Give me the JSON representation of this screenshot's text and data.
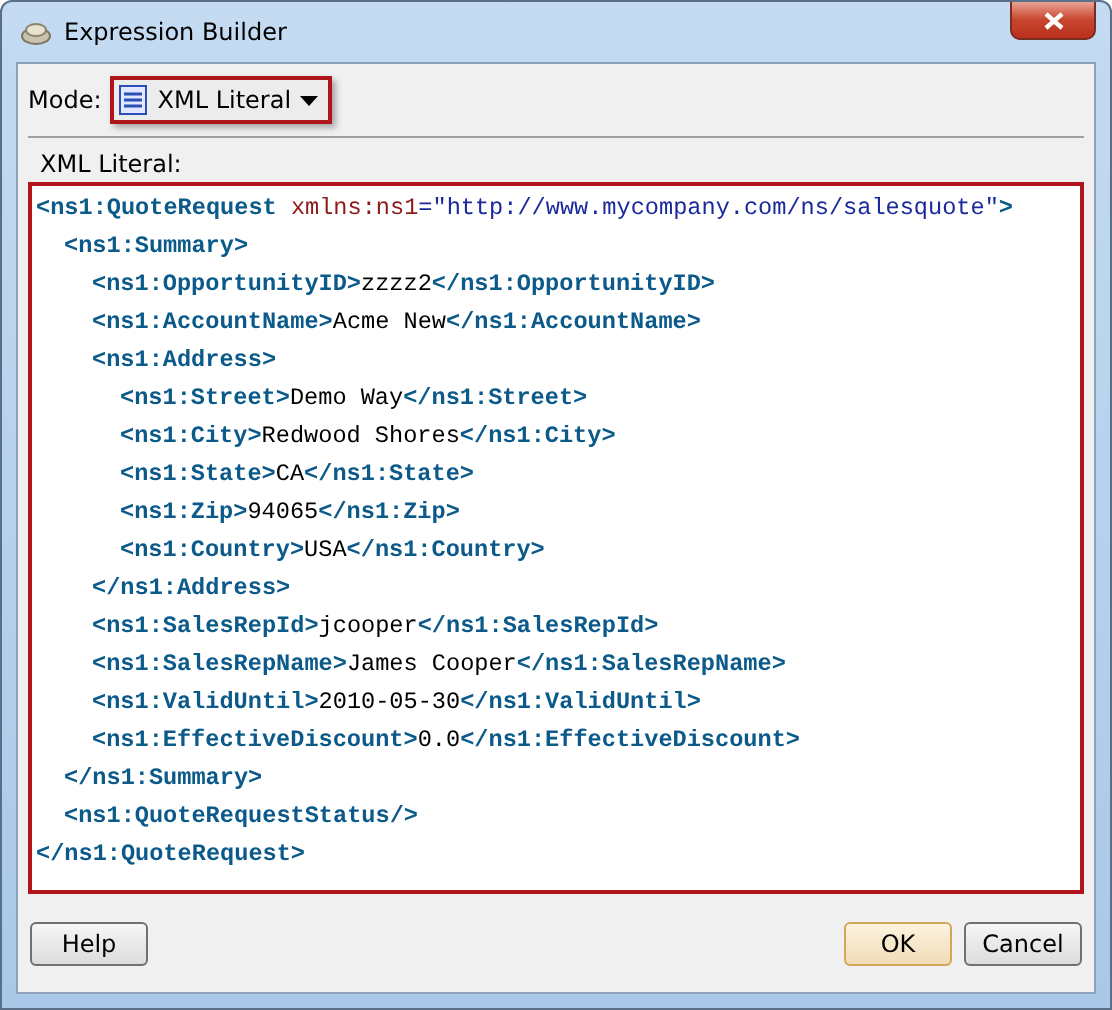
{
  "window": {
    "title": "Expression Builder"
  },
  "mode": {
    "label": "Mode:",
    "value": "XML Literal"
  },
  "editor": {
    "label": "XML Literal:",
    "tree": [
      {
        "parts": [
          {
            "kind": "tag",
            "text": "<ns1:QuoteRequest "
          },
          {
            "kind": "attr",
            "text": "xmlns:ns1"
          },
          {
            "kind": "value",
            "text": "=\"http://www.mycompany.com/ns/salesquote\""
          },
          {
            "kind": "tag",
            "text": ">"
          }
        ],
        "close": [
          {
            "kind": "tag",
            "text": "</ns1:QuoteRequest>"
          }
        ],
        "children": [
          {
            "parts": [
              {
                "kind": "tag",
                "text": "<ns1:Summary>"
              }
            ],
            "close": [
              {
                "kind": "tag",
                "text": "</ns1:Summary>"
              }
            ],
            "children": [
              {
                "parts": [
                  {
                    "kind": "tag",
                    "text": "<ns1:OpportunityID>"
                  },
                  {
                    "kind": "text",
                    "text": "zzzz2"
                  },
                  {
                    "kind": "tag",
                    "text": "</ns1:OpportunityID>"
                  }
                ]
              },
              {
                "parts": [
                  {
                    "kind": "tag",
                    "text": "<ns1:AccountName>"
                  },
                  {
                    "kind": "text",
                    "text": "Acme New"
                  },
                  {
                    "kind": "tag",
                    "text": "</ns1:AccountName>"
                  }
                ]
              },
              {
                "parts": [
                  {
                    "kind": "tag",
                    "text": "<ns1:Address>"
                  }
                ],
                "close": [
                  {
                    "kind": "tag",
                    "text": "</ns1:Address>"
                  }
                ],
                "children": [
                  {
                    "parts": [
                      {
                        "kind": "tag",
                        "text": "<ns1:Street>"
                      },
                      {
                        "kind": "text",
                        "text": "Demo Way"
                      },
                      {
                        "kind": "tag",
                        "text": "</ns1:Street>"
                      }
                    ]
                  },
                  {
                    "parts": [
                      {
                        "kind": "tag",
                        "text": "<ns1:City>"
                      },
                      {
                        "kind": "text",
                        "text": "Redwood Shores"
                      },
                      {
                        "kind": "tag",
                        "text": "</ns1:City>"
                      }
                    ]
                  },
                  {
                    "parts": [
                      {
                        "kind": "tag",
                        "text": "<ns1:State>"
                      },
                      {
                        "kind": "text",
                        "text": "CA"
                      },
                      {
                        "kind": "tag",
                        "text": "</ns1:State>"
                      }
                    ]
                  },
                  {
                    "parts": [
                      {
                        "kind": "tag",
                        "text": "<ns1:Zip>"
                      },
                      {
                        "kind": "text",
                        "text": "94065"
                      },
                      {
                        "kind": "tag",
                        "text": "</ns1:Zip>"
                      }
                    ]
                  },
                  {
                    "parts": [
                      {
                        "kind": "tag",
                        "text": "<ns1:Country>"
                      },
                      {
                        "kind": "text",
                        "text": "USA"
                      },
                      {
                        "kind": "tag",
                        "text": "</ns1:Country>"
                      }
                    ]
                  }
                ]
              },
              {
                "parts": [
                  {
                    "kind": "tag",
                    "text": "<ns1:SalesRepId>"
                  },
                  {
                    "kind": "text",
                    "text": "jcooper"
                  },
                  {
                    "kind": "tag",
                    "text": "</ns1:SalesRepId>"
                  }
                ]
              },
              {
                "parts": [
                  {
                    "kind": "tag",
                    "text": "<ns1:SalesRepName>"
                  },
                  {
                    "kind": "text",
                    "text": "James Cooper"
                  },
                  {
                    "kind": "tag",
                    "text": "</ns1:SalesRepName>"
                  }
                ]
              },
              {
                "parts": [
                  {
                    "kind": "tag",
                    "text": "<ns1:ValidUntil>"
                  },
                  {
                    "kind": "text",
                    "text": "2010-05-30"
                  },
                  {
                    "kind": "tag",
                    "text": "</ns1:ValidUntil>"
                  }
                ]
              },
              {
                "parts": [
                  {
                    "kind": "tag",
                    "text": "<ns1:EffectiveDiscount>"
                  },
                  {
                    "kind": "text",
                    "text": "0.0"
                  },
                  {
                    "kind": "tag",
                    "text": "</ns1:EffectiveDiscount>"
                  }
                ]
              }
            ]
          },
          {
            "parts": [
              {
                "kind": "tag",
                "text": "<ns1:QuoteRequestStatus/>"
              }
            ]
          }
        ]
      }
    ]
  },
  "buttons": [
    {
      "label": "Help",
      "kind": "plain"
    },
    {
      "label": "OK",
      "kind": "default"
    },
    {
      "label": "Cancel",
      "kind": "plain"
    }
  ]
}
